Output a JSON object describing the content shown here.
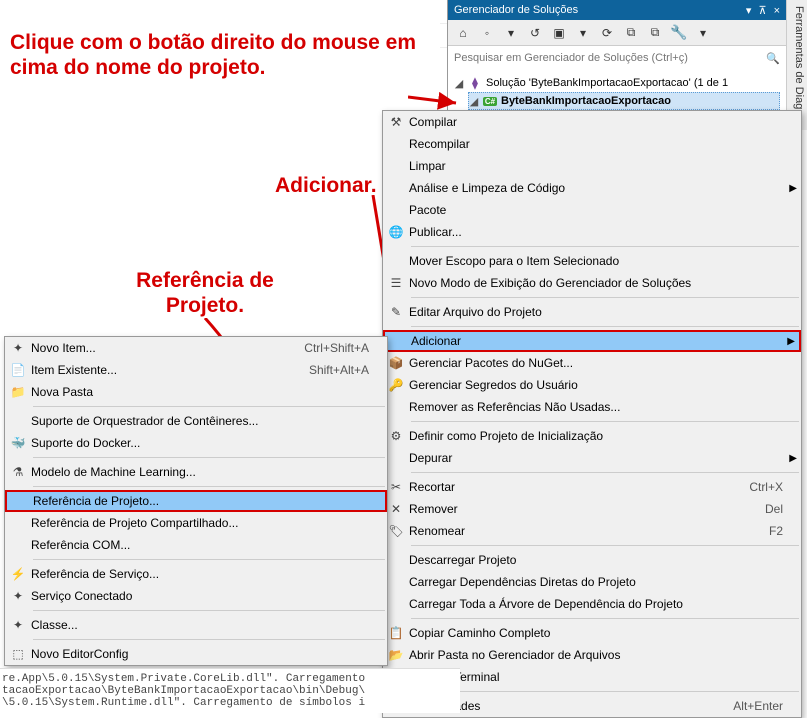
{
  "vtab": "Ferramentas de Diagr",
  "tl": {
    "gear": "⚙",
    "dd": "▾",
    "plus": "✚"
  },
  "solution_panel": {
    "title": "Gerenciador de Soluções",
    "pin": "⊼",
    "close": "×",
    "dd": "▾",
    "toolbar": {
      "home": "⌂",
      "back": "◦",
      "fwd": "↺",
      "props": "▣",
      "refresh": "⟳",
      "collapse": "⧉",
      "copy": "⧉",
      "tool": "🔧",
      "dd": "▾"
    },
    "search_ph": "Pesquisar em Gerenciador de Soluções (Ctrl+ç)",
    "search_icon": "🔍",
    "tree": {
      "sln_glyph": "◢",
      "sln_label": "Solução 'ByteBankImportacaoExportacao' (1 de 1",
      "proj_glyph": "◢",
      "proj_icon": "C#",
      "proj_label": "ByteBankImportacaoExportacao"
    }
  },
  "annotations": {
    "a1": "Clique com o botão direito do mouse em cima do nome do projeto.",
    "a2": "Adicionar.",
    "a3": "Referência de Projeto."
  },
  "main_menu": {
    "items": [
      {
        "icon": "⚒",
        "label": "Compilar"
      },
      {
        "icon": "",
        "label": "Recompilar"
      },
      {
        "icon": "",
        "label": "Limpar"
      },
      {
        "icon": "",
        "label": "Análise e Limpeza de Código",
        "sub": true
      },
      {
        "icon": "",
        "label": "Pacote"
      },
      {
        "icon": "🌐",
        "label": "Publicar..."
      },
      {
        "sep": true
      },
      {
        "icon": "",
        "label": "Mover Escopo para o Item Selecionado"
      },
      {
        "icon": "☰",
        "label": "Novo Modo de Exibição do Gerenciador de Soluções"
      },
      {
        "sep": true
      },
      {
        "icon": "✎",
        "label": "Editar Arquivo do Projeto"
      },
      {
        "sep": true
      },
      {
        "icon": "",
        "label": "Adicionar",
        "sub": true,
        "hl": true
      },
      {
        "icon": "📦",
        "label": "Gerenciar Pacotes do NuGet..."
      },
      {
        "icon": "🔑",
        "label": "Gerenciar Segredos do Usuário"
      },
      {
        "icon": "",
        "label": "Remover as Referências Não Usadas..."
      },
      {
        "sep": true
      },
      {
        "icon": "⚙",
        "label": "Definir como Projeto de Inicialização"
      },
      {
        "icon": "",
        "label": "Depurar",
        "sub": true
      },
      {
        "sep": true
      },
      {
        "icon": "✂",
        "label": "Recortar",
        "shortcut": "Ctrl+X"
      },
      {
        "icon": "✕",
        "label": "Remover",
        "shortcut": "Del"
      },
      {
        "icon": "🏷",
        "label": "Renomear",
        "shortcut": "F2"
      },
      {
        "sep": true
      },
      {
        "icon": "",
        "label": "Descarregar Projeto"
      },
      {
        "icon": "",
        "label": "Carregar Dependências Diretas do Projeto"
      },
      {
        "icon": "",
        "label": "Carregar Toda a Árvore de Dependência do Projeto"
      },
      {
        "sep": true
      },
      {
        "icon": "📋",
        "label": "Copiar Caminho Completo"
      },
      {
        "icon": "📂",
        "label": "Abrir Pasta no Gerenciador de Arquivos"
      },
      {
        "icon": ">_",
        "label": "Abrir no Terminal"
      },
      {
        "sep": true
      },
      {
        "icon": "🔧",
        "label": "Propriedades",
        "shortcut": "Alt+Enter"
      }
    ]
  },
  "sub_menu": {
    "items": [
      {
        "icon": "✦",
        "label": "Novo Item...",
        "shortcut": "Ctrl+Shift+A"
      },
      {
        "icon": "📄",
        "label": "Item Existente...",
        "shortcut": "Shift+Alt+A"
      },
      {
        "icon": "📁",
        "label": "Nova Pasta"
      },
      {
        "sep": true
      },
      {
        "icon": "",
        "label": "Suporte de Orquestrador de Contêineres..."
      },
      {
        "icon": "🐳",
        "label": "Suporte do Docker..."
      },
      {
        "sep": true
      },
      {
        "icon": "⚗",
        "label": "Modelo de Machine Learning..."
      },
      {
        "sep": true
      },
      {
        "icon": "",
        "label": "Referência de Projeto...",
        "hl": true
      },
      {
        "icon": "",
        "label": "Referência de Projeto Compartilhado..."
      },
      {
        "icon": "",
        "label": "Referência COM..."
      },
      {
        "sep": true
      },
      {
        "icon": "⚡",
        "label": "Referência de Serviço..."
      },
      {
        "icon": "✦",
        "label": "Serviço Conectado"
      },
      {
        "sep": true
      },
      {
        "icon": "✦",
        "label": "Classe..."
      },
      {
        "sep": true
      },
      {
        "icon": "⬚",
        "label": "Novo EditorConfig"
      }
    ]
  },
  "console": "re.App\\5.0.15\\System.Private.CoreLib.dll\". Carregamento\ntacaoExportacao\\ByteBankImportacaoExportacao\\bin\\Debug\\\n\\5.0.15\\System.Runtime.dll\". Carregamento de símbolos i"
}
